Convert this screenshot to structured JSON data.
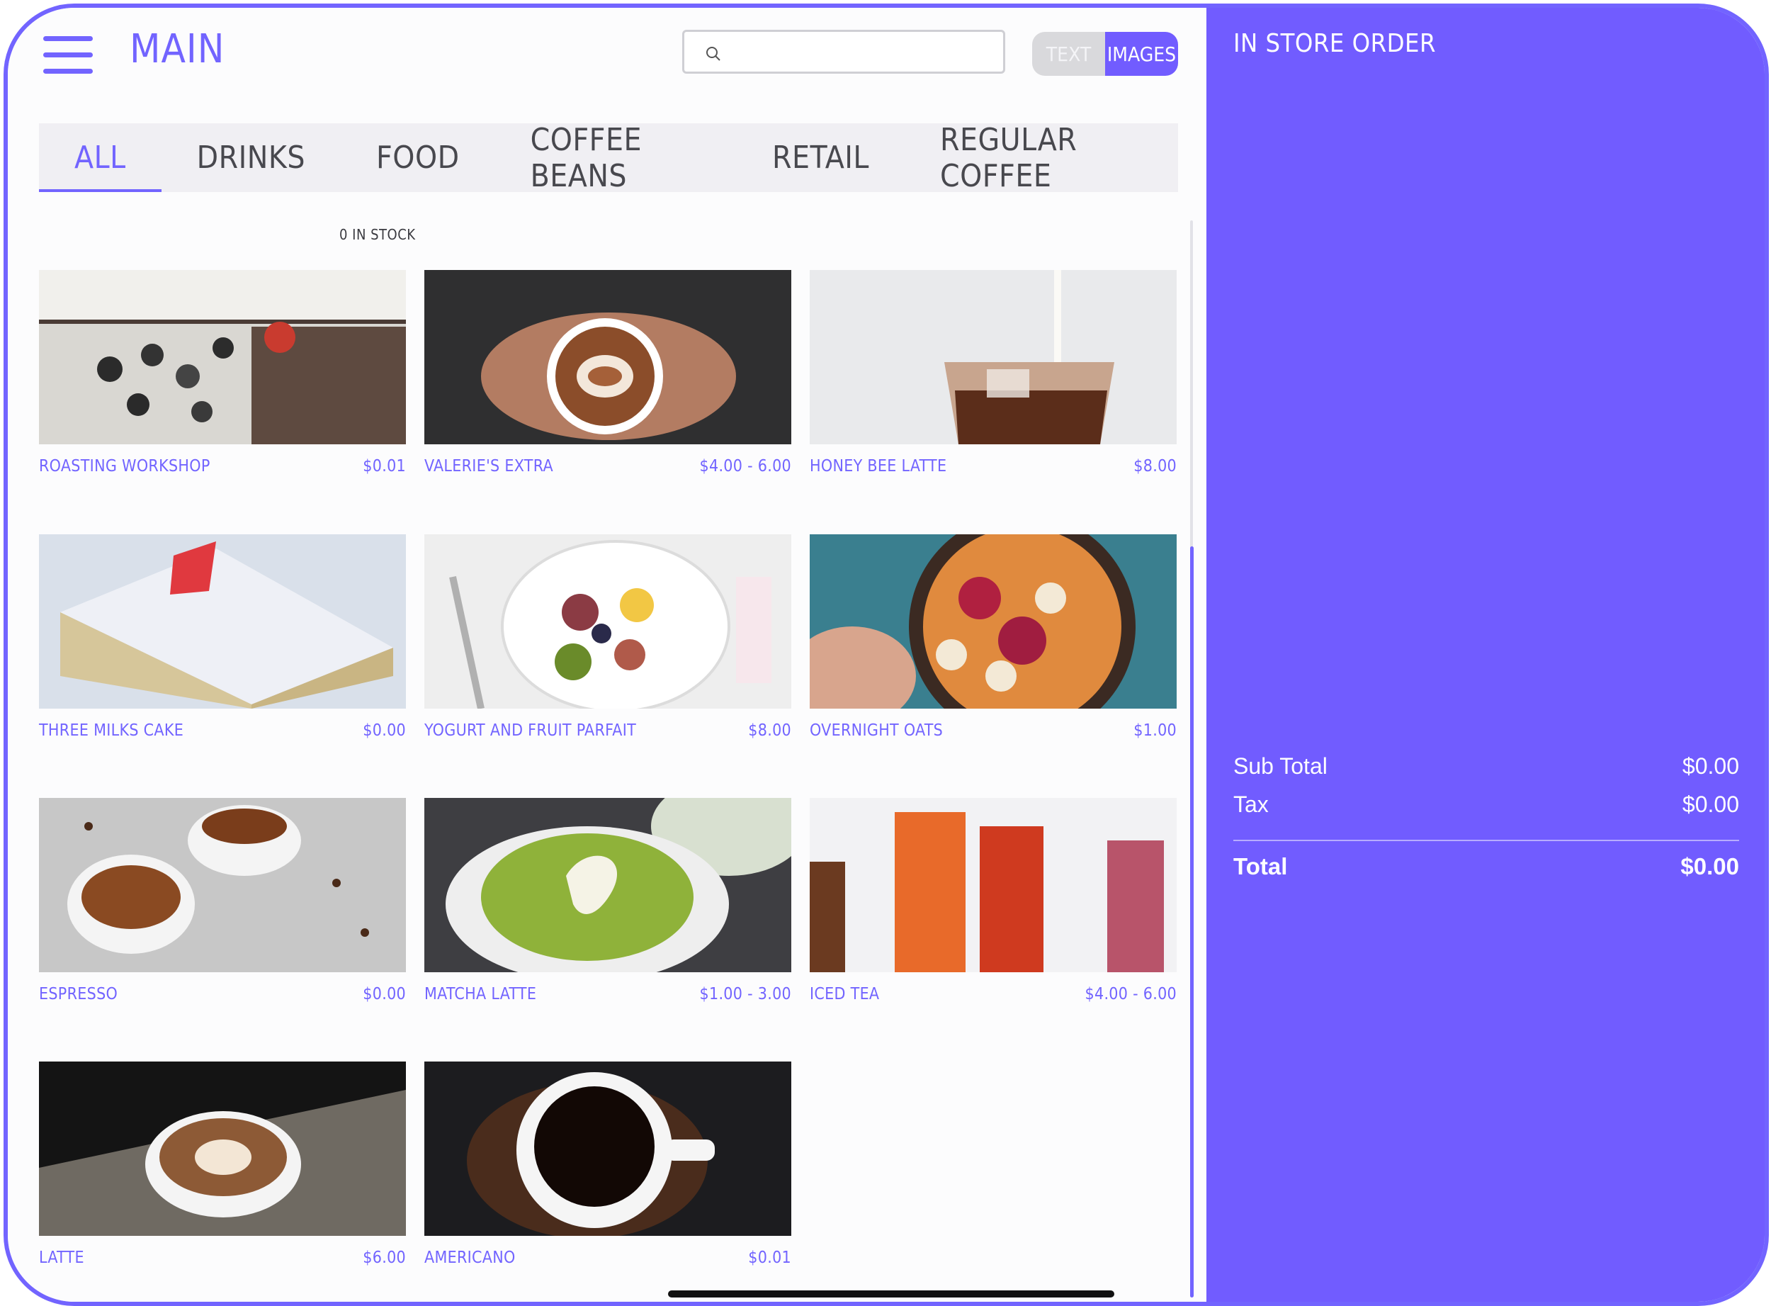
{
  "header": {
    "title": "MAIN",
    "search": {
      "placeholder": "",
      "value": ""
    }
  },
  "view_toggle": {
    "options": [
      "TEXT",
      "IMAGES"
    ],
    "selected": "IMAGES"
  },
  "tabs": [
    {
      "label": "ALL",
      "active": true
    },
    {
      "label": "DRINKS",
      "active": false
    },
    {
      "label": "FOOD",
      "active": false
    },
    {
      "label": "COFFEE BEANS",
      "active": false
    },
    {
      "label": "RETAIL",
      "active": false
    },
    {
      "label": "REGULAR COFFEE",
      "active": false
    }
  ],
  "stock_note": "0 IN STOCK",
  "products": [
    {
      "name": "ROASTING WORKSHOP",
      "price": "$0.01",
      "image": "coffee-shop-photo"
    },
    {
      "name": "VALERIE'S EXTRA",
      "price": "$4.00 - 6.00",
      "image": "latte-art-cup-photo"
    },
    {
      "name": "HONEY BEE LATTE",
      "price": "$8.00",
      "image": "iced-latte-photo"
    },
    {
      "name": "THREE MILKS CAKE",
      "price": "$0.00",
      "image": "cake-slice-photo"
    },
    {
      "name": "YOGURT AND FRUIT PARFAIT",
      "price": "$8.00",
      "image": "fruit-bowl-photo"
    },
    {
      "name": "OVERNIGHT OATS",
      "price": "$1.00",
      "image": "acai-bowl-photo"
    },
    {
      "name": "ESPRESSO",
      "price": "$0.00",
      "image": "espresso-cups-photo"
    },
    {
      "name": "MATCHA LATTE",
      "price": "$1.00 - 3.00",
      "image": "matcha-latte-photo"
    },
    {
      "name": "ICED TEA",
      "price": "$4.00 - 6.00",
      "image": "iced-tea-photo"
    },
    {
      "name": "LATTE",
      "price": "$6.00",
      "image": "latte-photo"
    },
    {
      "name": "AMERICANO",
      "price": "$0.01",
      "image": "americano-photo"
    }
  ],
  "order_panel": {
    "title": "IN STORE ORDER",
    "subtotal_label": "Sub Total",
    "subtotal_value": "$0.00",
    "tax_label": "Tax",
    "tax_value": "$0.00",
    "total_label": "Total",
    "total_value": "$0.00"
  },
  "colors": {
    "accent": "#715cff",
    "text": "#48484e",
    "tab_bg": "#f0eff3"
  }
}
